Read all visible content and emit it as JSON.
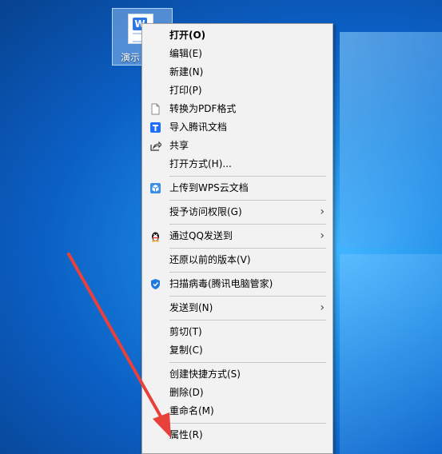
{
  "desktop": {
    "icon_label": "演示",
    "icon_badge": "W"
  },
  "menu": {
    "items": [
      {
        "label": "打开(O)",
        "bold": true
      },
      {
        "label": "编辑(E)"
      },
      {
        "label": "新建(N)"
      },
      {
        "label": "打印(P)"
      },
      {
        "label": "转换为PDF格式",
        "icon": "pdf-page-icon"
      },
      {
        "label": "导入腾讯文档",
        "icon": "tencent-docs-icon"
      },
      {
        "label": "共享",
        "icon": "share-icon"
      },
      {
        "label": "打开方式(H)..."
      },
      {
        "label": "上传到WPS云文档",
        "icon": "wps-cloud-icon"
      },
      {
        "label": "授予访问权限(G)",
        "submenu": true
      },
      {
        "label": "通过QQ发送到",
        "icon": "qq-penguin-icon",
        "submenu": true
      },
      {
        "label": "还原以前的版本(V)"
      },
      {
        "label": "扫描病毒(腾讯电脑管家)",
        "icon": "shield-icon"
      },
      {
        "label": "发送到(N)",
        "submenu": true
      },
      {
        "label": "剪切(T)"
      },
      {
        "label": "复制(C)"
      },
      {
        "label": "创建快捷方式(S)"
      },
      {
        "label": "删除(D)"
      },
      {
        "label": "重命名(M)"
      },
      {
        "label": "属性(R)"
      }
    ],
    "submenu_glyph": "›"
  },
  "colors": {
    "annotation": "#e8413b",
    "wallpaper": "#1a86e0"
  }
}
